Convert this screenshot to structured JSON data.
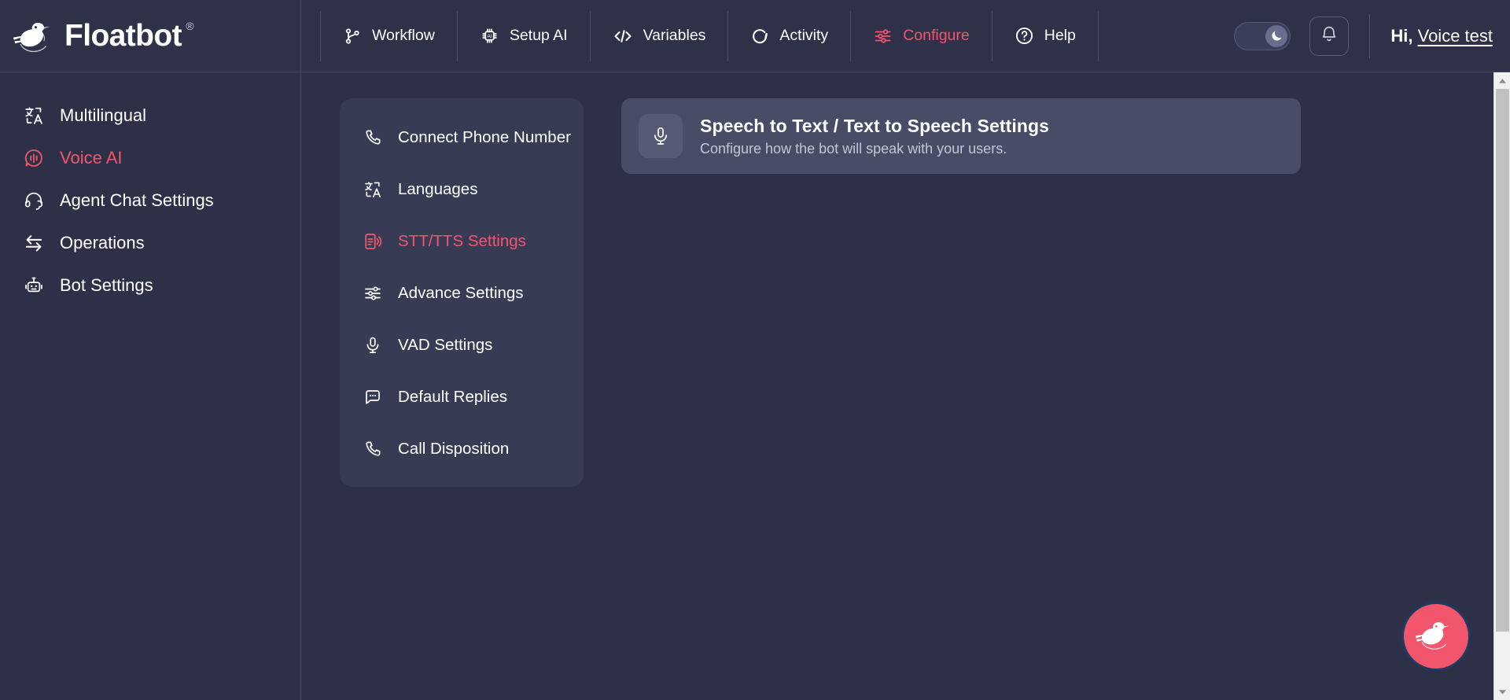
{
  "brand": {
    "wordmark": "Floatbot",
    "registered": "®",
    "logo_icon": "floatbot-bird-logo"
  },
  "topnav": {
    "items": [
      {
        "label": "Workflow",
        "icon": "git-branch-icon",
        "active": false
      },
      {
        "label": "Setup AI",
        "icon": "cpu-chip-ai-icon",
        "active": false
      },
      {
        "label": "Variables",
        "icon": "code-brackets-icon",
        "active": false
      },
      {
        "label": "Activity",
        "icon": "refresh-circle-icon",
        "active": false
      },
      {
        "label": "Configure",
        "icon": "sliders-icon",
        "active": true
      },
      {
        "label": "Help",
        "icon": "question-circle-icon",
        "active": false
      }
    ],
    "theme_toggle": {
      "icon": "moon-icon",
      "state": "dark",
      "name": "dark-mode-toggle"
    },
    "notifications": {
      "icon": "bell-icon"
    },
    "greeting_prefix": "Hi,",
    "user_name": "Voice test"
  },
  "sidebar": {
    "items": [
      {
        "label": "Multilingual",
        "icon": "translate-icon",
        "active": false
      },
      {
        "label": "Voice AI",
        "icon": "voice-wave-icon",
        "active": true
      },
      {
        "label": "Agent Chat Settings",
        "icon": "headset-icon",
        "active": false
      },
      {
        "label": "Operations",
        "icon": "exchange-arrows-icon",
        "active": false
      },
      {
        "label": "Bot Settings",
        "icon": "robot-icon",
        "active": false
      }
    ]
  },
  "menu_card": {
    "items": [
      {
        "label": "Connect Phone Number",
        "icon": "phone-icon",
        "active": false
      },
      {
        "label": "Languages",
        "icon": "translate-icon",
        "active": false
      },
      {
        "label": "STT/TTS Settings",
        "icon": "doc-speaker-icon",
        "active": true
      },
      {
        "label": "Advance Settings",
        "icon": "sliders-icon",
        "active": false
      },
      {
        "label": "VAD Settings",
        "icon": "microphone-icon",
        "active": false
      },
      {
        "label": "Default Replies",
        "icon": "chat-dots-icon",
        "active": false
      },
      {
        "label": "Call Disposition",
        "icon": "phone-icon",
        "active": false
      }
    ]
  },
  "panel": {
    "badge_icon": "microphone-icon",
    "title": "Speech to Text / Text to Speech Settings",
    "subtitle": "Configure how the bot will speak with your users."
  },
  "fab": {
    "icon": "floatbot-bird-logo"
  },
  "scrollbar": {
    "up_icon": "caret-up-icon",
    "down_icon": "caret-down-icon"
  },
  "colors": {
    "background": "#2e3047",
    "topbar": "#2f3149",
    "card": "#383b54",
    "panel": "#494c66",
    "accent": "#f2566c",
    "text": "#ffffff",
    "muted": "#c4c6d4",
    "divider": "#474a64"
  }
}
